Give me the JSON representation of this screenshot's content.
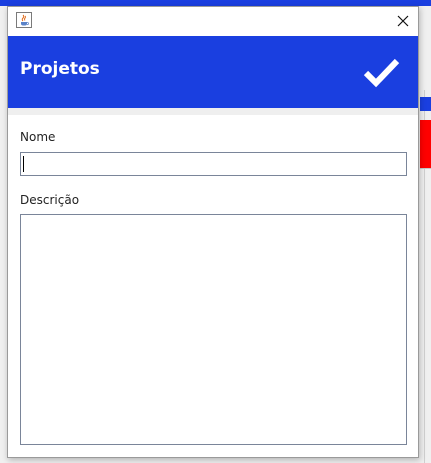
{
  "window": {
    "icon": "java-cup-icon",
    "close_icon": "close-icon"
  },
  "header": {
    "title": "Projetos",
    "confirm_icon": "checkmark-icon",
    "background_color": "#1a3fe0"
  },
  "form": {
    "nome": {
      "label": "Nome",
      "value": ""
    },
    "descricao": {
      "label": "Descrição",
      "value": ""
    }
  },
  "colors": {
    "accent": "#1a3fe0",
    "background_red": "#ff0000"
  }
}
